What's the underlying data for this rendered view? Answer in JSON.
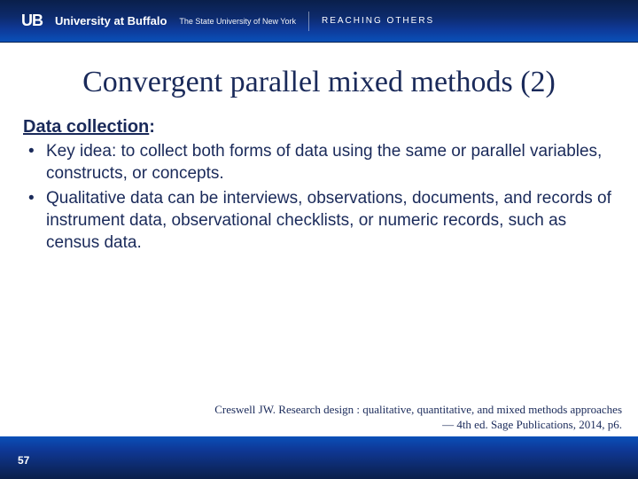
{
  "header": {
    "logo_mark": "UB",
    "university": "University at Buffalo",
    "system": "The State University of New York",
    "tagline": "REACHING OTHERS"
  },
  "title": "Convergent parallel mixed methods (2)",
  "section_head": "Data collection",
  "bullets": [
    "Key idea: to collect both forms of data using the same or parallel variables, constructs, or concepts.",
    "Qualitative data can be interviews, observations, documents, and records of instrument data, observational checklists, or numeric records, such as census data."
  ],
  "citation": {
    "line1": "Creswell JW.  Research design : qualitative, quantitative, and mixed methods approaches",
    "line2": "— 4th ed. Sage Publications, 2014, p6."
  },
  "page_number": "57"
}
